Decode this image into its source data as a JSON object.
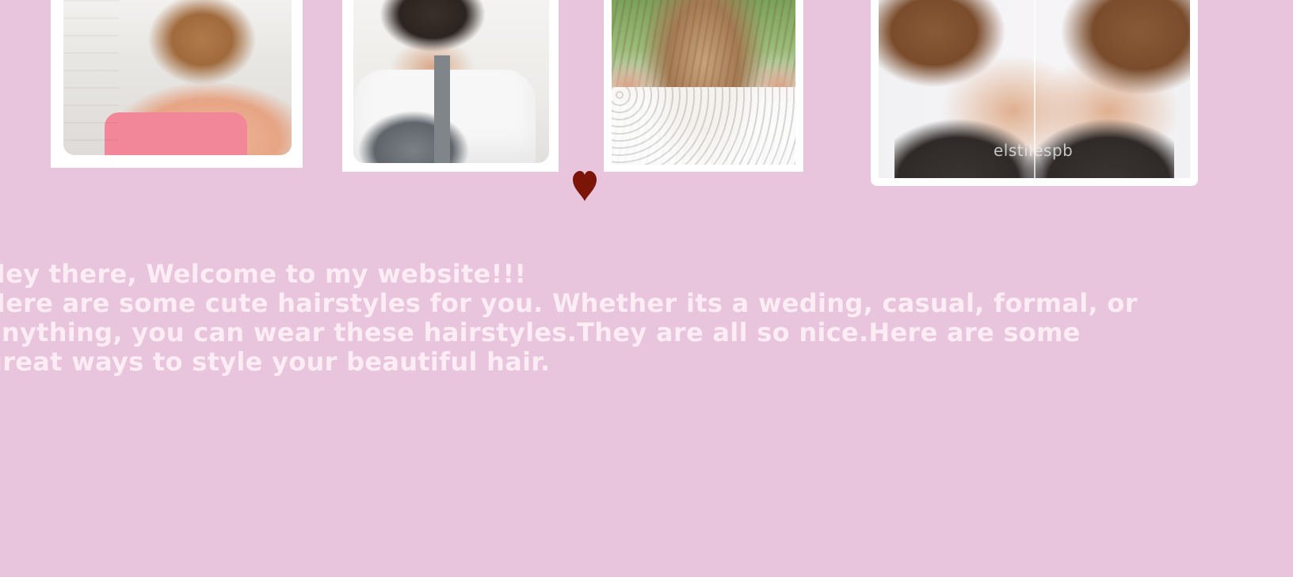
{
  "gallery": {
    "photos": [
      {
        "alt": "braided bun hairstyle"
      },
      {
        "alt": "french braids hairstyle"
      },
      {
        "alt": "long curly hairstyle"
      },
      {
        "alt": "messy updo hairstyle",
        "watermark": "elstilespb"
      }
    ]
  },
  "heart": {
    "icon": "heart-icon",
    "color": "#7a1508"
  },
  "intro": {
    "line1": "Hey there, Welcome to my website!!!",
    "line2": "Here are some cute hairstyles for you. Whether its a weding, casual, formal, or",
    "line3": "anything, you can wear these hairstyles.They are all so nice.Here are some",
    "line4": "great ways to style your beautiful hair."
  },
  "colors": {
    "background": "#e8c4dd",
    "text": "#fbedf3",
    "frame": "#ffffff"
  }
}
